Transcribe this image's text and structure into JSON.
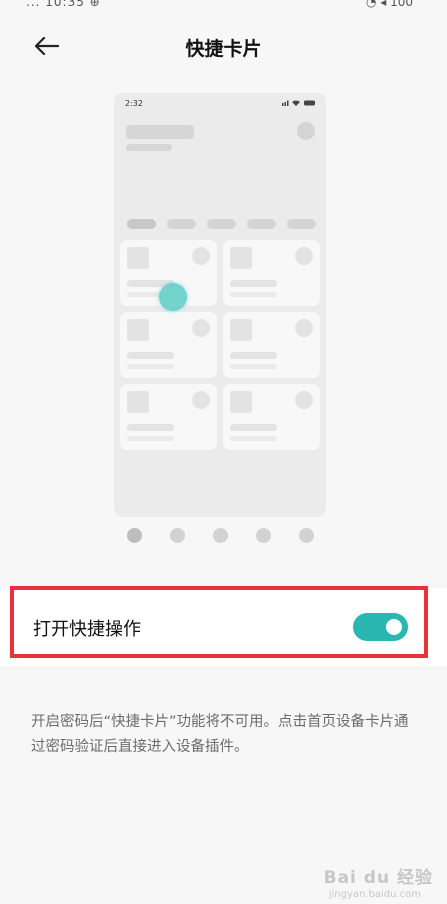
{
  "statusbar": {
    "left": "... 10:35 ⊕",
    "right": "◔ ◂ 100"
  },
  "header": {
    "title": "快捷卡片",
    "back_icon": "arrow-left-icon"
  },
  "preview": {
    "time": "2:32",
    "status_icons": [
      "signal-icon",
      "wifi-icon",
      "battery-icon"
    ],
    "touch_color": "#66cfc9"
  },
  "pager": {
    "count": 5,
    "active_index": 0
  },
  "setting": {
    "label": "打开快捷操作",
    "toggle_on": true,
    "toggle_color": "#2ab6b1",
    "highlight_color": "#e8323c"
  },
  "description": "开启密码后“快捷卡片”功能将不可用。点击首页设备卡片通过密码验证后直接进入设备插件。",
  "watermark": {
    "brand": "Bai du 经验",
    "url": "jingyan.baidu.com"
  }
}
